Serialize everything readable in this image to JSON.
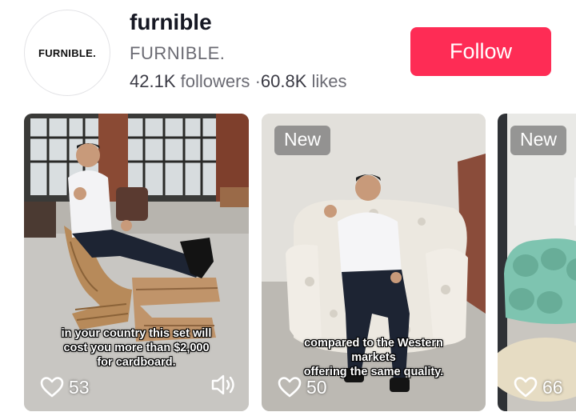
{
  "profile": {
    "avatar_text": "FURNIBLE.",
    "username": "furnible",
    "display_name": "FURNIBLE.",
    "followers_count": "42.1K",
    "followers_label": "followers",
    "separator": "·",
    "likes_count": "60.8K",
    "likes_label": "likes",
    "follow_label": "Follow"
  },
  "colors": {
    "follow": "#fe2c55",
    "text": "#161823",
    "muted": "#6b6b73"
  },
  "videos": [
    {
      "badge": "",
      "caption_lines": [
        "in your country this set will",
        "cost you more than $2,000",
        "for cardboard."
      ],
      "likes": "53",
      "icons": [
        "heart-icon",
        "speaker-icon"
      ]
    },
    {
      "badge": "New",
      "caption_lines": [
        "compared to the Western",
        "markets",
        "offering the same quality."
      ],
      "likes": "50",
      "icons": [
        "heart-icon"
      ]
    },
    {
      "badge": "New",
      "caption_lines": [],
      "likes": "66",
      "icons": [
        "heart-icon"
      ]
    }
  ]
}
